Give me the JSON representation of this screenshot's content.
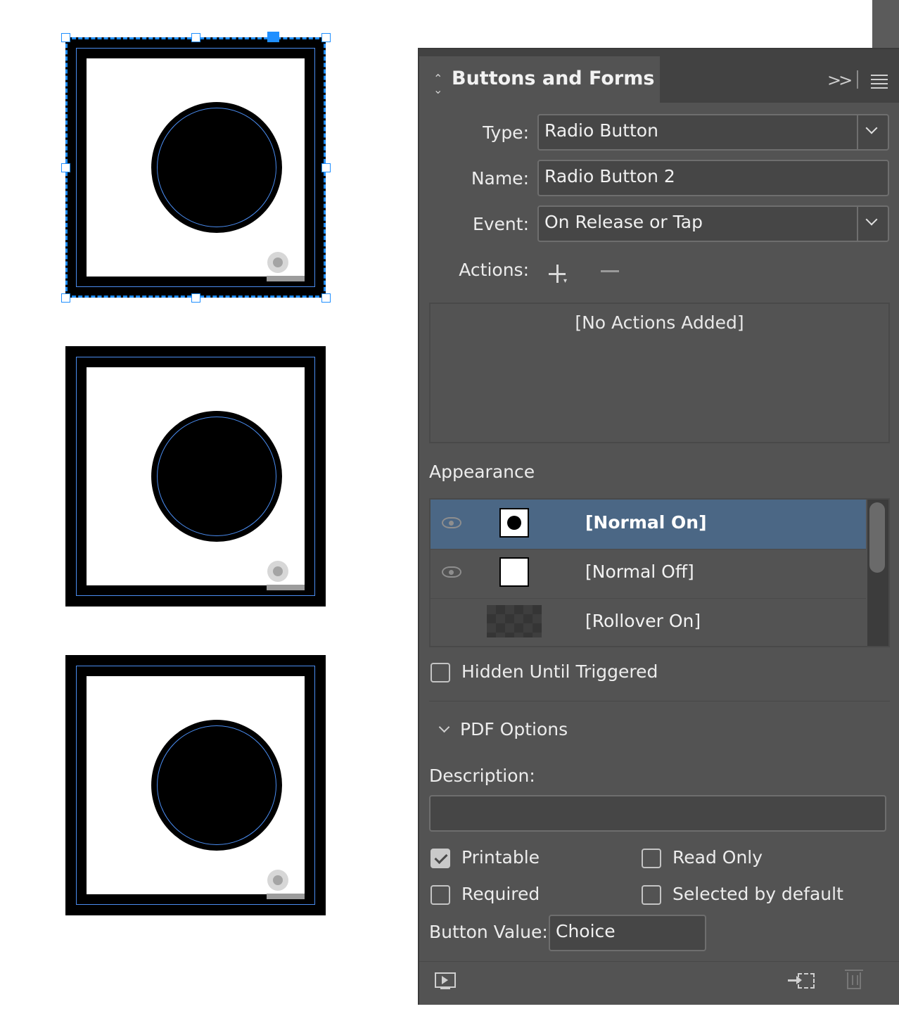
{
  "panel": {
    "title": "Buttons and Forms",
    "type_label": "Type:",
    "type_value": "Radio Button",
    "name_label": "Name:",
    "name_value": "Radio Button 2",
    "event_label": "Event:",
    "event_value": "On Release or Tap",
    "actions_label": "Actions:",
    "no_actions": "[No Actions Added]",
    "appearance_label": "Appearance",
    "states": [
      {
        "label": "[Normal On]",
        "selected": true
      },
      {
        "label": "[Normal Off]",
        "selected": false
      },
      {
        "label": "[Rollover On]",
        "selected": false
      }
    ],
    "hidden_until_triggered": "Hidden Until Triggered",
    "pdf_options": "PDF Options",
    "description_label": "Description:",
    "description_value": "",
    "printable": "Printable",
    "printable_checked": true,
    "read_only": "Read Only",
    "read_only_checked": false,
    "required": "Required",
    "required_checked": false,
    "selected_by_default": "Selected by default",
    "selected_by_default_checked": false,
    "button_value_label": "Button Value:",
    "button_value": "Choice"
  },
  "icons": {
    "panel_arrows": "up-down-arrows-icon",
    "collapse": "double-chevron-right-icon",
    "panel_menu": "hamburger-menu-icon",
    "dropdown": "chevron-down-icon",
    "add_action": "plus-icon",
    "remove_action": "minus-icon",
    "visibility": "eye-icon",
    "preview": "preview-spread-icon",
    "convert": "convert-to-object-icon",
    "delete": "trash-icon"
  },
  "colors": {
    "panel_bg": "#535353",
    "selection_blue": "#1f8fff",
    "selected_row": "#4b6785"
  }
}
